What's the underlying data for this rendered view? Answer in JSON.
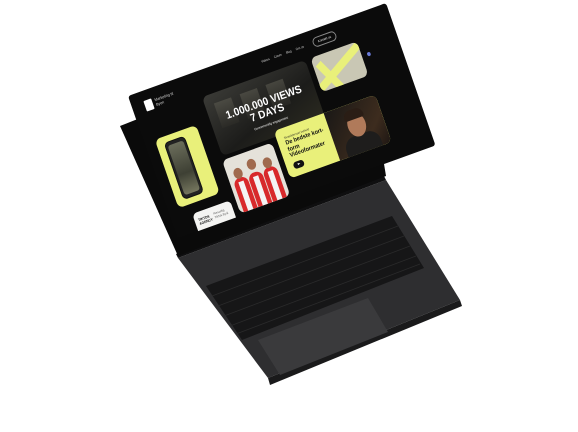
{
  "site": {
    "logo_text": "Marketing til Byen",
    "nav": [
      "Videos",
      "Cases",
      "Blog",
      "Om os"
    ],
    "cta": "Kontakt os",
    "hero_title": "1.000.000 VIEWS 7 DAYS",
    "hero_subtitle": "Gennemsnitlig engagement",
    "video_eyebrow": "Skræddersyet indhold",
    "video_title": "De bedste kort-form Videoformater",
    "agency_title": "TIKTOK AGENCY",
    "agency_text": "Personlig TikTok Byrå"
  },
  "colors": {
    "accent": "#e9f07a",
    "laptop_body": "#2b2b2d",
    "screen_bg": "#0b0b0b"
  }
}
